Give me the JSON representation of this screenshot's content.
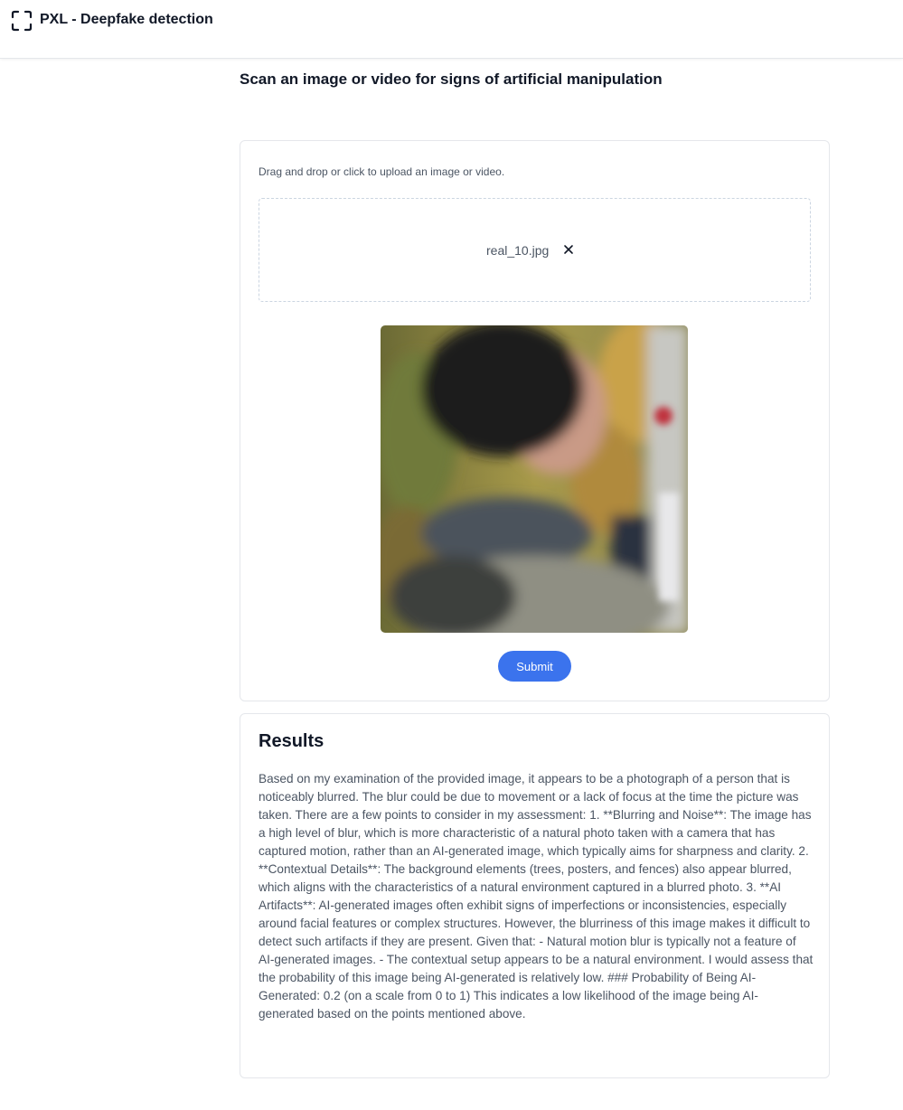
{
  "header": {
    "title": "PXL - Deepfake detection",
    "logo_icon": "scan-frame-icon"
  },
  "page": {
    "title": "Scan an image or video for signs of artificial manipulation"
  },
  "upload": {
    "hint": "Drag and drop or click to upload an image or video.",
    "file_name": "real_10.jpg",
    "remove_icon": "close-icon",
    "submit_label": "Submit",
    "accent_color": "#3b73ed"
  },
  "results": {
    "title": "Results",
    "text": "Based on my examination of the provided image, it appears to be a photograph of a person that is noticeably blurred. The blur could be due to movement or a lack of focus at the time the picture was taken. There are a few points to consider in my assessment: 1. **Blurring and Noise**: The image has a high level of blur, which is more characteristic of a natural photo taken with a camera that has captured motion, rather than an AI-generated image, which typically aims for sharpness and clarity. 2. **Contextual Details**: The background elements (trees, posters, and fences) also appear blurred, which aligns with the characteristics of a natural environment captured in a blurred photo. 3. **AI Artifacts**: AI-generated images often exhibit signs of imperfections or inconsistencies, especially around facial features or complex structures. However, the blurriness of this image makes it difficult to detect such artifacts if they are present. Given that: - Natural motion blur is typically not a feature of AI-generated images. - The contextual setup appears to be a natural environment. I would assess that the probability of this image being AI-generated is relatively low. ### Probability of Being AI-Generated: 0.2 (on a scale from 0 to 1) This indicates a low likelihood of the image being AI-generated based on the points mentioned above."
  }
}
